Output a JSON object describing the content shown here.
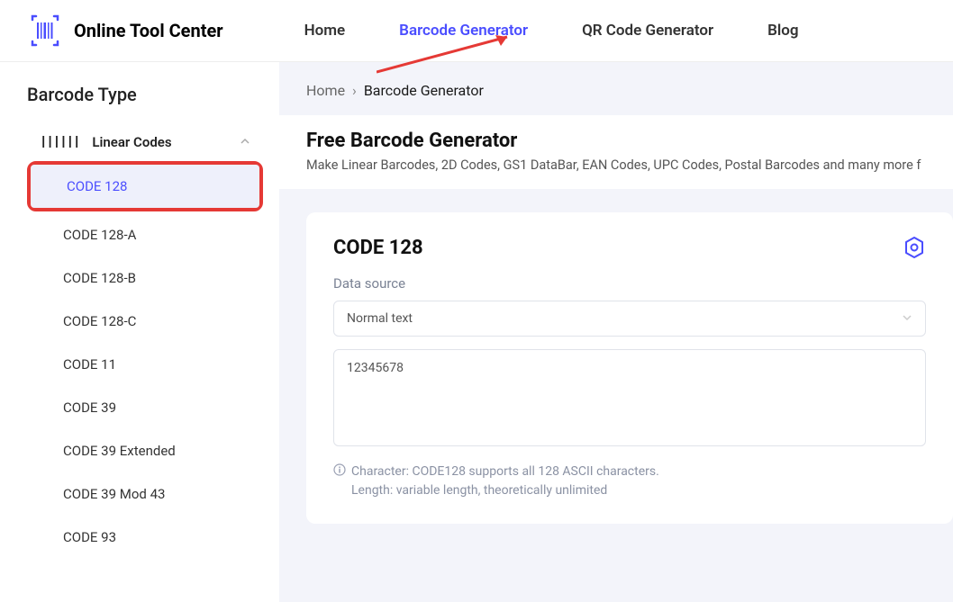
{
  "brand": "Online Tool Center",
  "nav": {
    "home": "Home",
    "barcode": "Barcode Generator",
    "qr": "QR Code Generator",
    "blog": "Blog"
  },
  "sidebar": {
    "title": "Barcode Type",
    "category": "Linear Codes",
    "items": [
      "CODE 128",
      "CODE 128-A",
      "CODE 128-B",
      "CODE 128-C",
      "CODE 11",
      "CODE 39",
      "CODE 39 Extended",
      "CODE 39 Mod 43",
      "CODE 93"
    ]
  },
  "breadcrumb": {
    "home": "Home",
    "current": "Barcode Generator"
  },
  "hero": {
    "title": "Free Barcode Generator",
    "subtitle": "Make Linear Barcodes, 2D Codes, GS1 DataBar, EAN Codes, UPC Codes, Postal Barcodes and many more f"
  },
  "card": {
    "title": "CODE 128",
    "data_source_label": "Data source",
    "select_value": "Normal text",
    "textarea_value": "12345678",
    "hint_line1": "Character: CODE128 supports all 128 ASCII characters.",
    "hint_line2": "Length: variable length, theoretically unlimited"
  }
}
